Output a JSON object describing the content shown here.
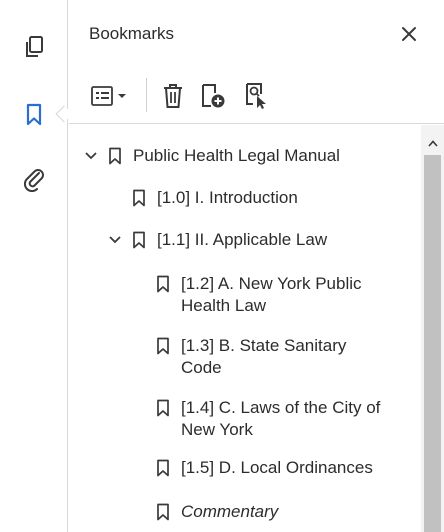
{
  "panel": {
    "title": "Bookmarks"
  },
  "icons": {
    "rail": [
      "pages-icon",
      "bookmark-icon",
      "attachment-icon"
    ],
    "toolbar": [
      "options-menu-icon",
      "delete-icon",
      "new-bookmark-icon",
      "find-bookmark-icon"
    ],
    "close": "close-icon"
  },
  "colors": {
    "accent": "#2a6ecf",
    "icon": "#3a3a3a",
    "scroll_track": "#f3f3f3",
    "scroll_thumb": "#c1c1c1"
  },
  "bookmarks": {
    "root": {
      "label": "Public Health Legal Manual",
      "expanded": true
    },
    "intro": {
      "label": "[1.0] I. Introduction"
    },
    "law": {
      "label": "[1.1] II. Applicable Law",
      "expanded": true
    },
    "nyphl": {
      "label": "[1.2] A. New York Public Health Law"
    },
    "ssc": {
      "label": "[1.3] B. State Sanitary Code"
    },
    "laws_city": {
      "label": "[1.4] C. Laws of the City of New York"
    },
    "ordinances": {
      "label": "[1.5] D. Local Ordinances"
    },
    "commentary": {
      "label": "Commentary"
    }
  }
}
